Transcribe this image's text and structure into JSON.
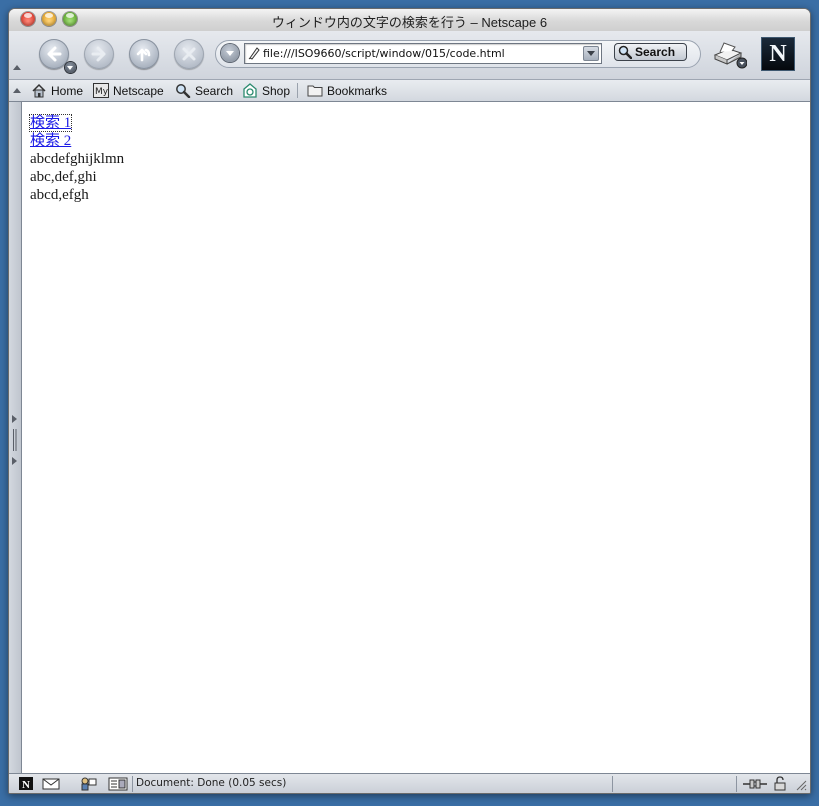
{
  "window": {
    "title": "ウィンドウ内の文字の検索を行う – Netscape 6"
  },
  "navbar": {
    "url": "file:///ISO9660/script/window/015/code.html",
    "search_label": "Search",
    "logo_letter": "N"
  },
  "personal_toolbar": {
    "items": [
      {
        "label": "Home",
        "icon": "home-icon"
      },
      {
        "label": "Netscape",
        "icon": "my-netscape-icon"
      },
      {
        "label": "Search",
        "icon": "magnifier-icon"
      },
      {
        "label": "Shop",
        "icon": "shop-icon"
      },
      {
        "label": "Bookmarks",
        "icon": "bookmarks-folder-icon"
      }
    ]
  },
  "content": {
    "links": [
      "検索 1",
      "検索 2"
    ],
    "lines": [
      "abcdefghijklmn",
      "abc,def,ghi",
      "abcd,efgh"
    ]
  },
  "statusbar": {
    "text": "Document: Done (0.05 secs)"
  },
  "colors": {
    "link": "#1a1ae6",
    "desktop": "#3a6ea5"
  }
}
